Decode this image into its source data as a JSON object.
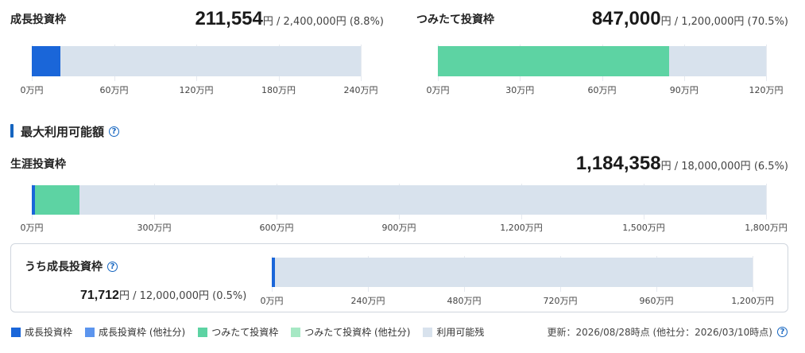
{
  "growth": {
    "title": "成長投資枠",
    "used": "211,554",
    "yen": "円",
    "limit_text": " / 2,400,000円 (8.8%)",
    "ticks": [
      "0万円",
      "60万円",
      "120万円",
      "180万円",
      "240万円"
    ],
    "fills": [
      {
        "series": "成長投資枠",
        "fraction": 0.088
      }
    ]
  },
  "tsumitate": {
    "title": "つみたて投資枠",
    "used": "847,000",
    "yen": "円",
    "limit_text": " / 1,200,000円 (70.5%)",
    "ticks": [
      "0万円",
      "30万円",
      "60万円",
      "90万円",
      "120万円"
    ],
    "fills": [
      {
        "series": "つみたて投資枠",
        "fraction": 0.705
      }
    ]
  },
  "max_section": {
    "title": "最大利用可能額",
    "help_icon": "question-circle-icon"
  },
  "lifetime": {
    "title": "生涯投資枠",
    "used": "1,184,358",
    "yen": "円",
    "limit_text": " / 18,000,000円 (6.5%)",
    "ticks": [
      "0万円",
      "300万円",
      "600万円",
      "900万円",
      "1,200万円",
      "1,500万円",
      "1,800万円"
    ],
    "fills": [
      {
        "series": "成長投資枠",
        "fraction": 0.004
      },
      {
        "series": "つみたて投資枠",
        "fraction": 0.061
      }
    ]
  },
  "growth_within": {
    "title": "うち成長投資枠",
    "help_icon": "question-circle-icon",
    "used": "71,712",
    "yen": "円",
    "limit_text": " / 12,000,000円 (0.5%)",
    "ticks": [
      "0万円",
      "240万円",
      "480万円",
      "720万円",
      "960万円",
      "1,200万円"
    ],
    "fills": [
      {
        "series": "成長投資枠",
        "fraction": 0.006
      }
    ]
  },
  "legend": [
    {
      "label": "成長投資枠",
      "color": "#1a66d9"
    },
    {
      "label": "成長投資枠 (他社分)",
      "color": "#5c95ee"
    },
    {
      "label": "つみたて投資枠",
      "color": "#5dd3a3"
    },
    {
      "label": "つみたて投資枠 (他社分)",
      "color": "#a6e8c4"
    },
    {
      "label": "利用可能残",
      "color": "#d8e2ed"
    }
  ],
  "colors": {
    "growth": "#1a66d9",
    "tsumitate": "#5dd3a3",
    "remaining": "#d8e2ed",
    "accent": "#1565c0"
  },
  "update_text": "更新：2026/08/28時点 (他社分：2026/03/10時点)",
  "update_help_icon": "question-circle-icon"
}
